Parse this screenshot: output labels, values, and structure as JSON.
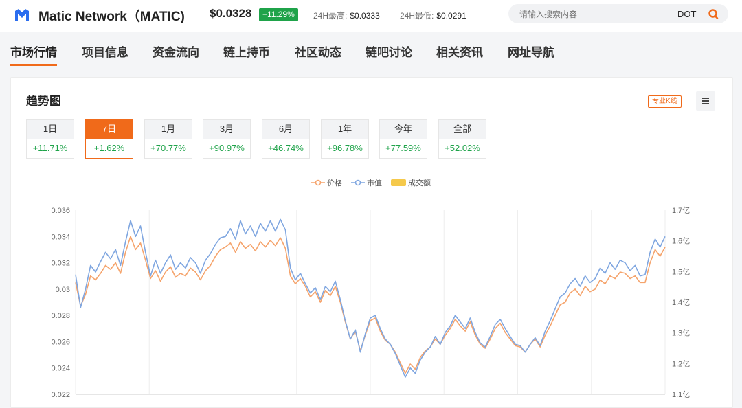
{
  "header": {
    "coin_name": "Matic Network（MATIC)",
    "price": "$0.0328",
    "change": "+11.29%",
    "high_label": "24H最高:",
    "high_value": "$0.0333",
    "low_label": "24H最低:",
    "low_value": "$0.0291",
    "search_placeholder": "请输入搜索内容",
    "search_chip": "DOT",
    "logo_icon": "matic-logo-icon",
    "search_icon": "search-icon",
    "colors": {
      "badge": "#1fa34a",
      "accent": "#f06a1a",
      "logo": "#2b6def"
    }
  },
  "tabs": [
    {
      "label": "市场行情",
      "active": true
    },
    {
      "label": "项目信息"
    },
    {
      "label": "资金流向"
    },
    {
      "label": "链上持币"
    },
    {
      "label": "社区动态"
    },
    {
      "label": "链吧讨论"
    },
    {
      "label": "相关资讯"
    },
    {
      "label": "网址导航"
    }
  ],
  "card": {
    "title": "趋势图",
    "kline_label": "专业K线",
    "menu_icon": "menu-icon"
  },
  "periods": [
    {
      "label": "1日",
      "change": "+11.71%"
    },
    {
      "label": "7日",
      "change": "+1.62%",
      "active": true
    },
    {
      "label": "1月",
      "change": "+70.77%"
    },
    {
      "label": "3月",
      "change": "+90.97%"
    },
    {
      "label": "6月",
      "change": "+46.74%"
    },
    {
      "label": "1年",
      "change": "+96.78%"
    },
    {
      "label": "今年",
      "change": "+77.59%"
    },
    {
      "label": "全部",
      "change": "+52.02%"
    }
  ],
  "chart_data": {
    "type": "line",
    "legend": [
      "价格",
      "市值",
      "成交额"
    ],
    "legend_placement": "top-center",
    "series_colors": {
      "价格": "#f5a36b",
      "市值": "#7fa6e0",
      "成交额": "#f5c94b"
    },
    "y_left_ticks": [
      "0.036",
      "0.034",
      "0.032",
      "0.03",
      "0.028",
      "0.026",
      "0.024",
      "0.022"
    ],
    "y_left_range": [
      0.022,
      0.036
    ],
    "y_right_ticks": [
      "1.7亿",
      "1.6亿",
      "1.5亿",
      "1.4亿",
      "1.3亿",
      "1.2亿",
      "1.1亿"
    ],
    "y_right_range": [
      1.1,
      1.7
    ],
    "grid_vertical": true,
    "series": [
      {
        "name": "价格",
        "values": [
          0.0305,
          0.0287,
          0.0296,
          0.031,
          0.0307,
          0.0312,
          0.0318,
          0.0315,
          0.032,
          0.0312,
          0.0328,
          0.034,
          0.033,
          0.0335,
          0.0322,
          0.0308,
          0.0314,
          0.0306,
          0.0313,
          0.0317,
          0.0309,
          0.0312,
          0.031,
          0.0316,
          0.0313,
          0.0307,
          0.0314,
          0.0318,
          0.0325,
          0.033,
          0.0332,
          0.0335,
          0.0328,
          0.0336,
          0.0331,
          0.0334,
          0.0329,
          0.0336,
          0.0332,
          0.0337,
          0.0333,
          0.0339,
          0.0331,
          0.031,
          0.0304,
          0.0308,
          0.0302,
          0.0294,
          0.0298,
          0.029,
          0.0299,
          0.0295,
          0.0302,
          0.029,
          0.0275,
          0.0262,
          0.0268,
          0.0253,
          0.0265,
          0.0276,
          0.0278,
          0.0268,
          0.0261,
          0.0258,
          0.0252,
          0.0244,
          0.0236,
          0.0243,
          0.0239,
          0.0248,
          0.0253,
          0.0256,
          0.0262,
          0.0258,
          0.0265,
          0.027,
          0.0277,
          0.0272,
          0.0268,
          0.0275,
          0.0265,
          0.0258,
          0.0255,
          0.0262,
          0.027,
          0.0274,
          0.0267,
          0.0262,
          0.0257,
          0.0256,
          0.0252,
          0.0258,
          0.0262,
          0.0256,
          0.0265,
          0.0272,
          0.028,
          0.0288,
          0.029,
          0.0297,
          0.03,
          0.0295,
          0.0302,
          0.0298,
          0.03,
          0.0307,
          0.0304,
          0.031,
          0.0308,
          0.0313,
          0.0312,
          0.0308,
          0.031,
          0.0305,
          0.0305,
          0.032,
          0.033,
          0.0325,
          0.0332
        ]
      },
      {
        "name": "市值",
        "values": [
          0.0311,
          0.0286,
          0.03,
          0.0318,
          0.0313,
          0.0321,
          0.0328,
          0.0323,
          0.033,
          0.0318,
          0.0336,
          0.0352,
          0.034,
          0.0348,
          0.0328,
          0.031,
          0.0322,
          0.0312,
          0.032,
          0.0326,
          0.0315,
          0.032,
          0.0316,
          0.0324,
          0.032,
          0.0312,
          0.0322,
          0.0327,
          0.0334,
          0.0339,
          0.034,
          0.0346,
          0.0338,
          0.0352,
          0.0342,
          0.0348,
          0.034,
          0.035,
          0.0344,
          0.0352,
          0.0344,
          0.0353,
          0.0345,
          0.0316,
          0.0307,
          0.0312,
          0.0304,
          0.0297,
          0.0301,
          0.0292,
          0.0302,
          0.0298,
          0.0306,
          0.0292,
          0.0276,
          0.0262,
          0.0269,
          0.0252,
          0.0266,
          0.0278,
          0.028,
          0.027,
          0.0262,
          0.0258,
          0.0251,
          0.0242,
          0.0233,
          0.024,
          0.0236,
          0.0246,
          0.0252,
          0.0256,
          0.0264,
          0.0258,
          0.0267,
          0.0272,
          0.028,
          0.0275,
          0.027,
          0.0278,
          0.0267,
          0.0259,
          0.0256,
          0.0264,
          0.0273,
          0.0277,
          0.027,
          0.0264,
          0.0258,
          0.0257,
          0.0252,
          0.0258,
          0.0263,
          0.0257,
          0.0268,
          0.0276,
          0.0285,
          0.0294,
          0.0297,
          0.0304,
          0.0308,
          0.0302,
          0.031,
          0.0305,
          0.0308,
          0.0316,
          0.0312,
          0.032,
          0.0315,
          0.0322,
          0.032,
          0.0314,
          0.0318,
          0.031,
          0.0311,
          0.0328,
          0.0338,
          0.0332,
          0.034
        ]
      }
    ]
  }
}
